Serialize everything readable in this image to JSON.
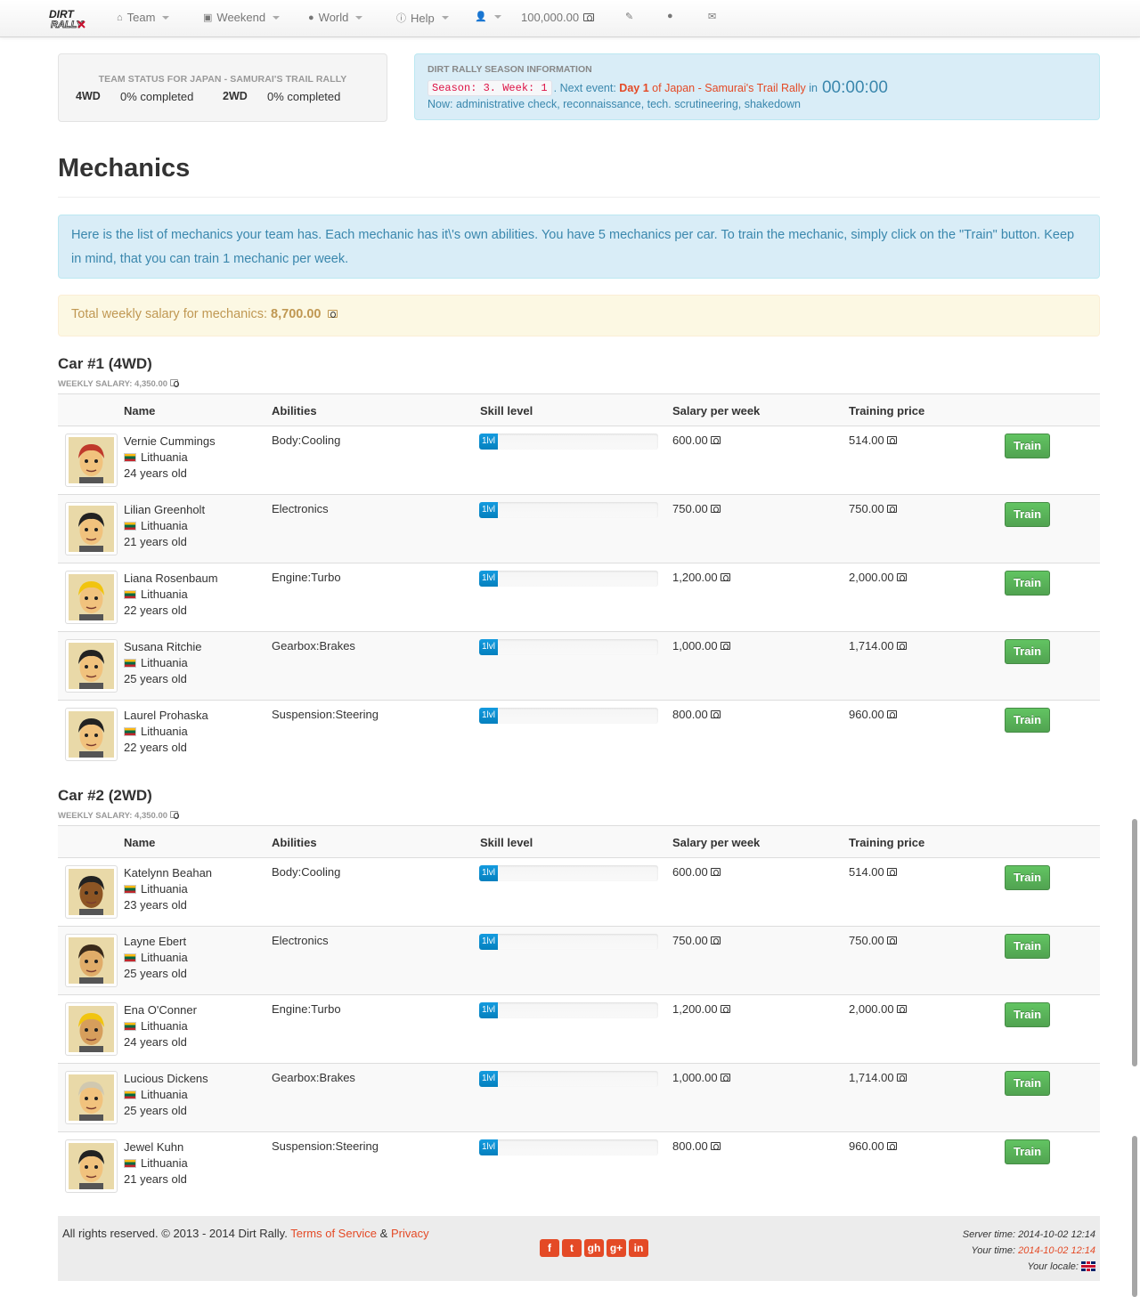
{
  "nav": {
    "brand": "DIRT RALLY",
    "team": "Team",
    "weekend": "Weekend",
    "world": "World",
    "help": "Help",
    "balance": "100,000.00"
  },
  "team_status": {
    "title": "TEAM STATUS FOR JAPAN - SAMURAI'S TRAIL RALLY",
    "items": [
      {
        "label": "4WD",
        "value": "0% completed"
      },
      {
        "label": "2WD",
        "value": "0% completed"
      }
    ]
  },
  "season": {
    "title": "DIRT RALLY SEASON INFORMATION",
    "code": "Season: 3. Week: 1",
    "next_event_prefix": ". Next event:",
    "day": "Day 1",
    "of": "of",
    "event": "Japan - Samurai's Trail Rally",
    "in": "in",
    "timer": "00:00:00",
    "now": "Now: administrative check, reconnaissance, tech. scrutineering, shakedown"
  },
  "page": {
    "title": "Mechanics",
    "info": "Here is the list of mechanics your team has. Each mechanic has it\\'s own abilities. You have 5 mechanics per car. To train the mechanic, simply click on the \"Train\" button. Keep in mind, that you can train 1 mechanic per week.",
    "salary_prefix": "Total weekly salary for mechanics:",
    "salary_total": "8,700.00"
  },
  "table_headers": {
    "name": "Name",
    "abilities": "Abilities",
    "skill": "Skill level",
    "salary": "Salary per week",
    "training": "Training price"
  },
  "cars": [
    {
      "title": "Car #1 (4WD)",
      "weekly": "WEEKLY SALARY: 4,350.00",
      "mechanics": [
        {
          "name": "Vernie Cummings",
          "country": "Lithuania",
          "age": "24 years old",
          "ability": "Body:Cooling",
          "level": "1lvl",
          "salary": "600.00",
          "price": "514.00",
          "train": "Train"
        },
        {
          "name": "Lilian Greenholt",
          "country": "Lithuania",
          "age": "21 years old",
          "ability": "Electronics",
          "level": "1lvl",
          "salary": "750.00",
          "price": "750.00",
          "train": "Train"
        },
        {
          "name": "Liana Rosenbaum",
          "country": "Lithuania",
          "age": "22 years old",
          "ability": "Engine:Turbo",
          "level": "1lvl",
          "salary": "1,200.00",
          "price": "2,000.00",
          "train": "Train"
        },
        {
          "name": "Susana Ritchie",
          "country": "Lithuania",
          "age": "25 years old",
          "ability": "Gearbox:Brakes",
          "level": "1lvl",
          "salary": "1,000.00",
          "price": "1,714.00",
          "train": "Train"
        },
        {
          "name": "Laurel Prohaska",
          "country": "Lithuania",
          "age": "22 years old",
          "ability": "Suspension:Steering",
          "level": "1lvl",
          "salary": "800.00",
          "price": "960.00",
          "train": "Train"
        }
      ]
    },
    {
      "title": "Car #2 (2WD)",
      "weekly": "WEEKLY SALARY: 4,350.00",
      "mechanics": [
        {
          "name": "Katelynn Beahan",
          "country": "Lithuania",
          "age": "23 years old",
          "ability": "Body:Cooling",
          "level": "1lvl",
          "salary": "600.00",
          "price": "514.00",
          "train": "Train"
        },
        {
          "name": "Layne Ebert",
          "country": "Lithuania",
          "age": "25 years old",
          "ability": "Electronics",
          "level": "1lvl",
          "salary": "750.00",
          "price": "750.00",
          "train": "Train"
        },
        {
          "name": "Ena O'Conner",
          "country": "Lithuania",
          "age": "24 years old",
          "ability": "Engine:Turbo",
          "level": "1lvl",
          "salary": "1,200.00",
          "price": "2,000.00",
          "train": "Train"
        },
        {
          "name": "Lucious Dickens",
          "country": "Lithuania",
          "age": "25 years old",
          "ability": "Gearbox:Brakes",
          "level": "1lvl",
          "salary": "1,000.00",
          "price": "1,714.00",
          "train": "Train"
        },
        {
          "name": "Jewel Kuhn",
          "country": "Lithuania",
          "age": "21 years old",
          "ability": "Suspension:Steering",
          "level": "1lvl",
          "salary": "800.00",
          "price": "960.00",
          "train": "Train"
        }
      ]
    }
  ],
  "footer": {
    "copy": "All rights reserved. © 2013 - 2014 Dirt Rally.",
    "terms": "Terms of Service",
    "amp": "&",
    "privacy": "Privacy",
    "social": [
      "f",
      "t",
      "gh",
      "g+",
      "in"
    ],
    "server_time": "Server time: 2014-10-02 12:14",
    "your_time_label": "Your time:",
    "your_time": "2014-10-02 12:14",
    "locale": "Your locale:"
  },
  "colors": {
    "accent": "#e44a26",
    "info_bg": "#d9edf7",
    "warning_bg": "#fcf8e3",
    "train_btn": "#5bb75b",
    "progress": "#0480be"
  }
}
